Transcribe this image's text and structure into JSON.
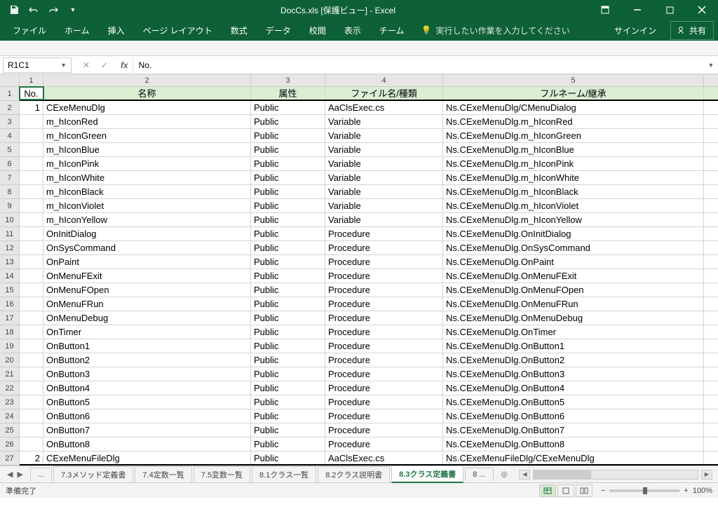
{
  "title": "DocCs.xls  [保護ビュー] - Excel",
  "ribbon": {
    "file": "ファイル",
    "home": "ホーム",
    "insert": "挿入",
    "layout": "ページ レイアウト",
    "formulas": "数式",
    "data": "データ",
    "review": "校閲",
    "view": "表示",
    "team": "チーム",
    "tellme": "実行したい作業を入力してください",
    "signin": "サインイン",
    "share": "共有"
  },
  "nameBox": "R1C1",
  "formula": "No.",
  "colHeaders": [
    "1",
    "2",
    "3",
    "4",
    "5"
  ],
  "headerRow": {
    "c1": "No.",
    "c2": "名称",
    "c3": "属性",
    "c4": "ファイル名/種類",
    "c5": "フルネーム/継承"
  },
  "rows": [
    {
      "n": "1",
      "c2": "CExeMenuDlg",
      "c3": "Public",
      "c4": "AaClsExec.cs",
      "c5": "Ns.CExeMenuDlg/CMenuDialog"
    },
    {
      "n": "",
      "c2": "m_hIconRed",
      "c3": "Public",
      "c4": "Variable",
      "c5": "Ns.CExeMenuDlg.m_hIconRed"
    },
    {
      "n": "",
      "c2": "m_hIconGreen",
      "c3": "Public",
      "c4": "Variable",
      "c5": "Ns.CExeMenuDlg.m_hIconGreen"
    },
    {
      "n": "",
      "c2": "m_hIconBlue",
      "c3": "Public",
      "c4": "Variable",
      "c5": "Ns.CExeMenuDlg.m_hIconBlue"
    },
    {
      "n": "",
      "c2": "m_hIconPink",
      "c3": "Public",
      "c4": "Variable",
      "c5": "Ns.CExeMenuDlg.m_hIconPink"
    },
    {
      "n": "",
      "c2": "m_hIconWhite",
      "c3": "Public",
      "c4": "Variable",
      "c5": "Ns.CExeMenuDlg.m_hIconWhite"
    },
    {
      "n": "",
      "c2": "m_hIconBlack",
      "c3": "Public",
      "c4": "Variable",
      "c5": "Ns.CExeMenuDlg.m_hIconBlack"
    },
    {
      "n": "",
      "c2": "m_hIconViolet",
      "c3": "Public",
      "c4": "Variable",
      "c5": "Ns.CExeMenuDlg.m_hIconViolet"
    },
    {
      "n": "",
      "c2": "m_hIconYellow",
      "c3": "Public",
      "c4": "Variable",
      "c5": "Ns.CExeMenuDlg.m_hIconYellow"
    },
    {
      "n": "",
      "c2": "OnInitDialog",
      "c3": "Public",
      "c4": "Procedure",
      "c5": "Ns.CExeMenuDlg.OnInitDialog"
    },
    {
      "n": "",
      "c2": "OnSysCommand",
      "c3": "Public",
      "c4": "Procedure",
      "c5": "Ns.CExeMenuDlg.OnSysCommand"
    },
    {
      "n": "",
      "c2": "OnPaint",
      "c3": "Public",
      "c4": "Procedure",
      "c5": "Ns.CExeMenuDlg.OnPaint"
    },
    {
      "n": "",
      "c2": "OnMenuFExit",
      "c3": "Public",
      "c4": "Procedure",
      "c5": "Ns.CExeMenuDlg.OnMenuFExit"
    },
    {
      "n": "",
      "c2": "OnMenuFOpen",
      "c3": "Public",
      "c4": "Procedure",
      "c5": "Ns.CExeMenuDlg.OnMenuFOpen"
    },
    {
      "n": "",
      "c2": "OnMenuFRun",
      "c3": "Public",
      "c4": "Procedure",
      "c5": "Ns.CExeMenuDlg.OnMenuFRun"
    },
    {
      "n": "",
      "c2": "OnMenuDebug",
      "c3": "Public",
      "c4": "Procedure",
      "c5": "Ns.CExeMenuDlg.OnMenuDebug"
    },
    {
      "n": "",
      "c2": "OnTimer",
      "c3": "Public",
      "c4": "Procedure",
      "c5": "Ns.CExeMenuDlg.OnTimer"
    },
    {
      "n": "",
      "c2": "OnButton1",
      "c3": "Public",
      "c4": "Procedure",
      "c5": "Ns.CExeMenuDlg.OnButton1"
    },
    {
      "n": "",
      "c2": "OnButton2",
      "c3": "Public",
      "c4": "Procedure",
      "c5": "Ns.CExeMenuDlg.OnButton2"
    },
    {
      "n": "",
      "c2": "OnButton3",
      "c3": "Public",
      "c4": "Procedure",
      "c5": "Ns.CExeMenuDlg.OnButton3"
    },
    {
      "n": "",
      "c2": "OnButton4",
      "c3": "Public",
      "c4": "Procedure",
      "c5": "Ns.CExeMenuDlg.OnButton4"
    },
    {
      "n": "",
      "c2": "OnButton5",
      "c3": "Public",
      "c4": "Procedure",
      "c5": "Ns.CExeMenuDlg.OnButton5"
    },
    {
      "n": "",
      "c2": "OnButton6",
      "c3": "Public",
      "c4": "Procedure",
      "c5": "Ns.CExeMenuDlg.OnButton6"
    },
    {
      "n": "",
      "c2": "OnButton7",
      "c3": "Public",
      "c4": "Procedure",
      "c5": "Ns.CExeMenuDlg.OnButton7"
    },
    {
      "n": "",
      "c2": "OnButton8",
      "c3": "Public",
      "c4": "Procedure",
      "c5": "Ns.CExeMenuDlg.OnButton8"
    },
    {
      "n": "2",
      "c2": "CExeMenuFileDlg",
      "c3": "Public",
      "c4": "AaClsExec.cs",
      "c5": "Ns.CExeMenuFileDlg/CExeMenuDlg"
    }
  ],
  "sheets": {
    "ellipsis": "...",
    "s1": "7.3メソッド定義書",
    "s2": "7.4定数一覧",
    "s3": "7.5変数一覧",
    "s4": "8.1クラス一覧",
    "s5": "8.2クラス説明書",
    "s6": "8.3クラス定義書",
    "s7": "8  ..."
  },
  "status": {
    "ready": "準備完了",
    "zoom": "100%"
  }
}
